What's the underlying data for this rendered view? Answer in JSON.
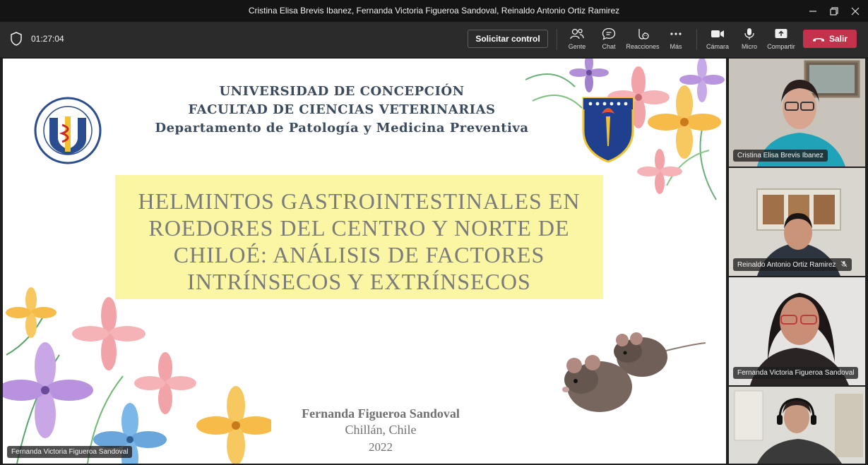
{
  "window": {
    "title": "Cristina Elisa Brevis Ibanez, Fernanda Victoria Figueroa Sandoval, Reinaldo Antonio Ortiz Ramirez"
  },
  "toolbar": {
    "timer": "01:27:04",
    "request_control": "Solicitar control",
    "people": "Gente",
    "chat": "Chat",
    "reactions": "Reacciones",
    "more": "Más",
    "camera": "Cámara",
    "mic": "Micro",
    "share": "Compartir",
    "leave": "Salir"
  },
  "slide": {
    "university": "UNIVERSIDAD  DE  CONCEPCIÓN",
    "faculty": "FACULTAD DE CIENCIAS VETERINARIAS",
    "department": "Departamento de Patología y Medicina Preventiva",
    "title_lines": [
      "HELMINTOS GASTROINTESTINALES EN",
      "ROEDORES DEL CENTRO Y NORTE DE",
      "CHILOÉ: ANÁLISIS DE FACTORES",
      "INTRÍNSECOS Y EXTRÍNSECOS"
    ],
    "author": "Fernanda Figueroa Sandoval",
    "place": "Chillán, Chile",
    "year": "2022",
    "presenter_label": "Fernanda Victoria Figueroa Sandoval"
  },
  "participants": [
    {
      "name": "Cristina Elisa Brevis Ibanez",
      "muted": false
    },
    {
      "name": "Reinaldo Antonio Ortiz Ramirez",
      "muted": true
    },
    {
      "name": "Fernanda Victoria Figueroa Sandoval",
      "muted": false
    },
    {
      "name": "",
      "muted": false
    }
  ],
  "colors": {
    "leave_button": "#c4314b",
    "title_highlight": "#fbf6a3",
    "toolbar_bg": "#2b2b2b"
  }
}
